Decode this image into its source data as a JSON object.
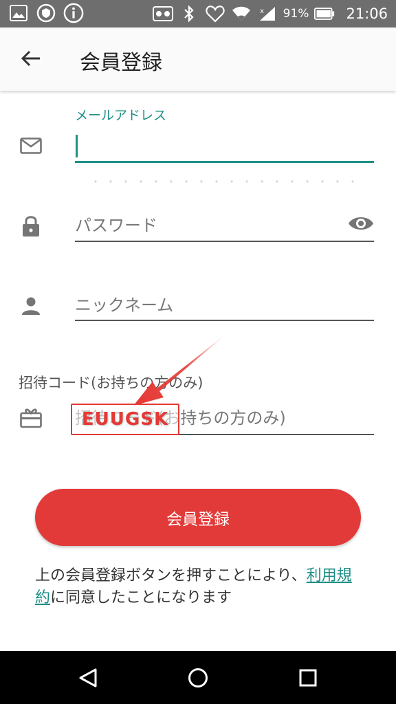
{
  "status_bar": {
    "battery_percent": "91%",
    "time": "21:06",
    "icons": [
      "gallery-icon",
      "shield-icon",
      "info-icon",
      "voicemail-icon",
      "bluetooth-icon",
      "heart-icon",
      "wifi-icon",
      "signal-icon",
      "battery-icon"
    ]
  },
  "header": {
    "title": "会員登録",
    "back_icon": "arrow-back-icon"
  },
  "form": {
    "email": {
      "label": "メールアドレス",
      "value": "",
      "icon": "mail-icon"
    },
    "password": {
      "placeholder": "パスワード",
      "icon": "lock-icon",
      "toggle_icon": "eye-icon"
    },
    "nickname": {
      "placeholder": "ニックネーム",
      "icon": "person-icon"
    },
    "invite": {
      "section_label": "招待コード(お持ちの方のみ)",
      "placeholder": "招待コード(お持ちの方のみ)",
      "icon": "gift-card-icon"
    }
  },
  "annotation": {
    "code": "EUUGSK",
    "color": "#e53935"
  },
  "submit": {
    "label": "会員登録",
    "color": "#e23a38"
  },
  "terms": {
    "prefix": "上の会員登録ボタンを押すことにより、",
    "link": "利用規約",
    "suffix": "に同意したことになります"
  },
  "colors": {
    "accent": "#1e8f85",
    "status_bar": "#6e6e6e"
  },
  "nav_bar": {
    "icons": [
      "back-triangle-icon",
      "home-circle-icon",
      "recents-square-icon"
    ]
  }
}
